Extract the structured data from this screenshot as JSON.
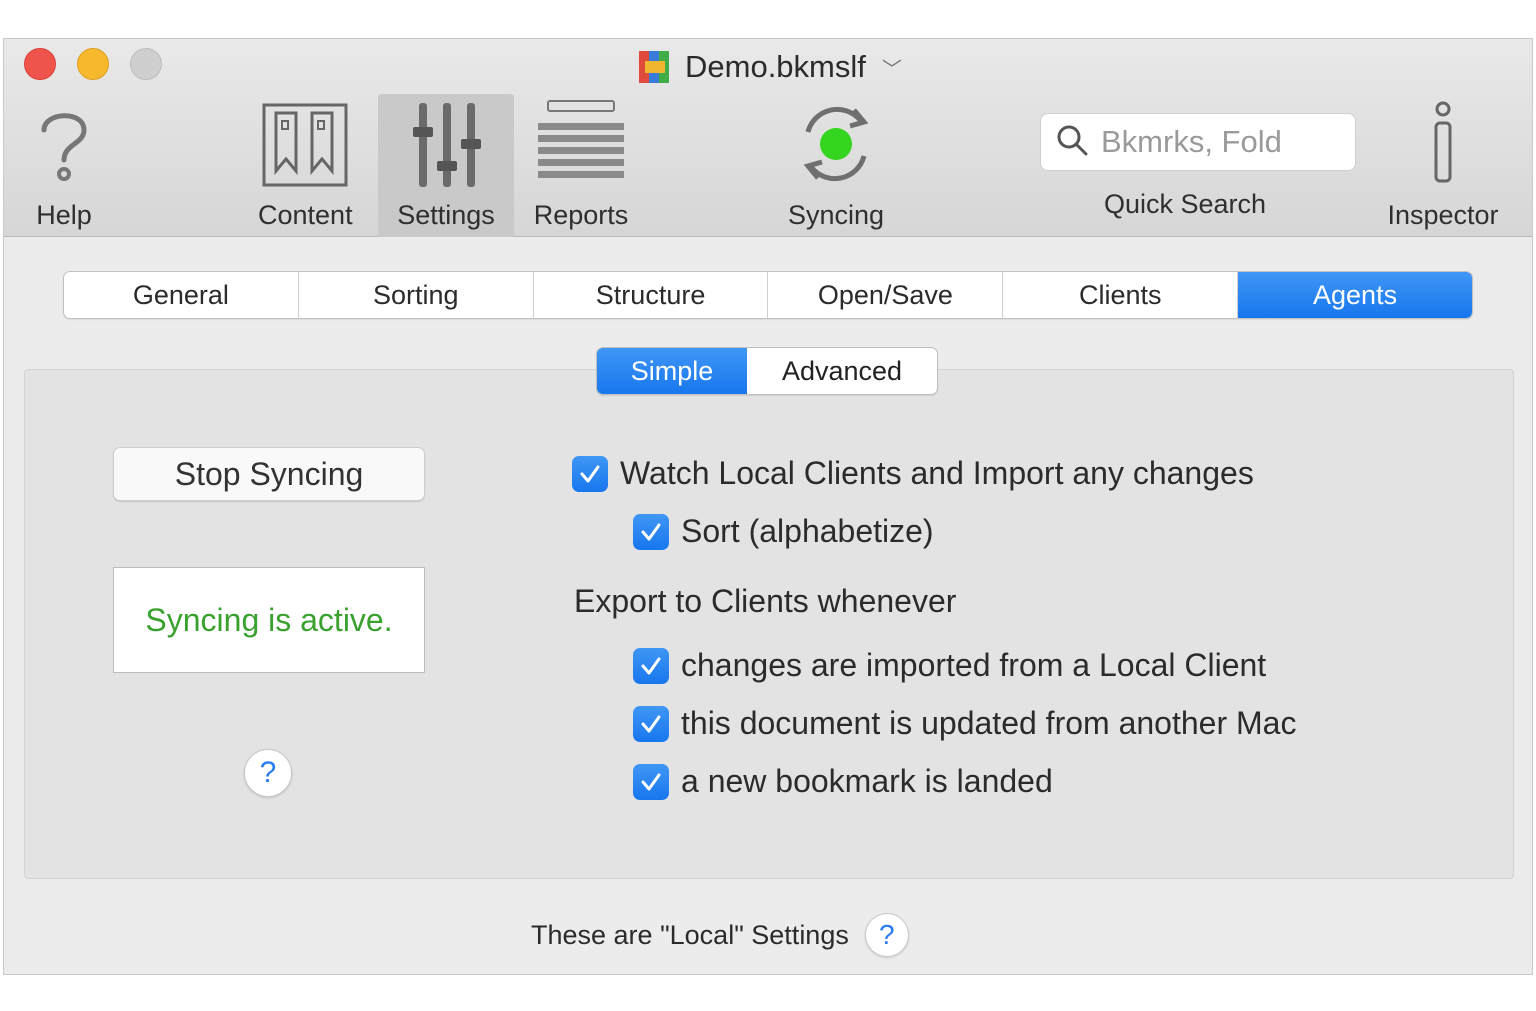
{
  "window": {
    "title": "Demo.bkmslf"
  },
  "toolbar": {
    "help_label": "Help",
    "content_label": "Content",
    "settings_label": "Settings",
    "reports_label": "Reports",
    "syncing_label": "Syncing",
    "search_placeholder": "Bkmrks, Fold",
    "quick_search_label": "Quick Search",
    "inspector_label": "Inspector",
    "icons": [
      "question-mark-icon",
      "bookmarks-icon",
      "sliders-icon",
      "list-icon",
      "sync-arrows-icon",
      "search-icon",
      "info-icon"
    ]
  },
  "tabs": [
    {
      "label": "General",
      "active": false
    },
    {
      "label": "Sorting",
      "active": false
    },
    {
      "label": "Structure",
      "active": false
    },
    {
      "label": "Open/Save",
      "active": false
    },
    {
      "label": "Clients",
      "active": false
    },
    {
      "label": "Agents",
      "active": true
    }
  ],
  "segment": {
    "simple_label": "Simple",
    "advanced_label": "Advanced",
    "selected": "Simple"
  },
  "agents": {
    "stop_button_label": "Stop Syncing",
    "status_text": "Syncing is active.",
    "watch_label": "Watch Local Clients and Import any changes",
    "sort_label": "Sort (alphabetize)",
    "export_heading": "Export to Clients whenever",
    "export_options": [
      {
        "label": "changes are imported from a Local Client",
        "checked": true
      },
      {
        "label": "this document is updated from another Mac",
        "checked": true
      },
      {
        "label": "a new bookmark is landed",
        "checked": true
      }
    ],
    "watch_checked": true,
    "sort_checked": true,
    "help_glyph": "?"
  },
  "footer": {
    "text": "These are \"Local\" Settings",
    "help_glyph": "?"
  },
  "colors": {
    "accent": "#1f7ff0",
    "status_green": "#3aa12f",
    "sync_dot": "#34d51f"
  }
}
